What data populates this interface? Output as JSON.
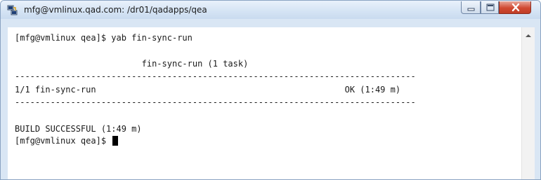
{
  "window": {
    "title": "mfg@vmlinux.qad.com: /dr01/qadapps/qea",
    "app_icon": "putty-icon",
    "controls": {
      "minimize_icon": "minimize-icon",
      "maximize_icon": "maximize-icon",
      "close_icon": "close-icon"
    }
  },
  "terminal": {
    "lines": [
      "[mfg@vmlinux qea]$ yab fin-sync-run",
      "",
      "                         fin-sync-run (1 task)",
      "-------------------------------------------------------------------------------",
      "1/1 fin-sync-run                                                 OK (1:49 m)",
      "-------------------------------------------------------------------------------",
      "",
      "",
      "BUILD SUCCESSFUL (1:49 m)"
    ],
    "prompt": "[mfg@vmlinux qea]$ "
  },
  "scrollbar": {
    "up_arrow_icon": "scroll-up-arrow-icon"
  }
}
